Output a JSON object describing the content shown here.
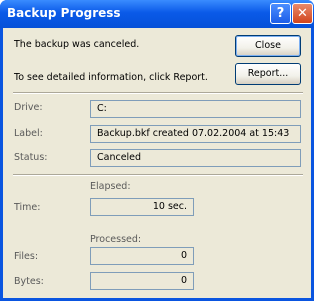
{
  "window": {
    "title": "Backup Progress",
    "help_label": "?",
    "close_label": "✕"
  },
  "status_message": "The backup was canceled.",
  "report_hint": "To see detailed information, click Report.",
  "buttons": {
    "close_label": "Close",
    "report_label": "Report..."
  },
  "details": {
    "drive_label": "Drive:",
    "drive_value": "C:",
    "label_label": "Label:",
    "label_value": "Backup.bkf created 07.02.2004 at 15:43",
    "status_label": "Status:",
    "status_value": "Canceled"
  },
  "progress": {
    "elapsed_header": "Elapsed:",
    "time_label": "Time:",
    "time_value": "10 sec.",
    "processed_header": "Processed:",
    "files_label": "Files:",
    "files_value": "0",
    "bytes_label": "Bytes:",
    "bytes_value": "0"
  }
}
